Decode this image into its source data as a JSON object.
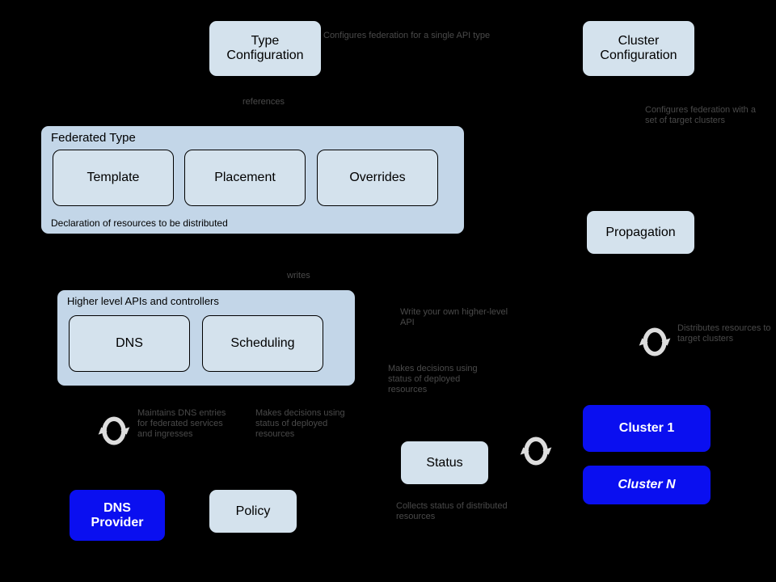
{
  "nodes": {
    "type_config": "Type\nConfiguration",
    "cluster_config": "Cluster\nConfiguration",
    "federated_type": {
      "title": "Federated Type",
      "subtitle": "Declaration of resources to be distributed",
      "template": "Template",
      "placement": "Placement",
      "overrides": "Overrides"
    },
    "propagation": "Propagation",
    "higher_apis": {
      "title": "Higher level APIs and controllers",
      "dns": "DNS",
      "scheduling": "Scheduling"
    },
    "dns_provider": "DNS\nProvider",
    "policy": "Policy",
    "status": "Status",
    "cluster1": "Cluster 1",
    "clusterN": "Cluster N"
  },
  "edges": {
    "type_to_prop": "Configures federation for a single API type",
    "cluster_to_prop": "Configures federation with a set of target clusters",
    "fed_references": "references",
    "sched_writes": "writes",
    "higher_api_note": "Write your own higher-level API",
    "sched_status": "Makes decisions using status of deployed resources",
    "dns_maintain": "Maintains DNS entries for federated services and ingresses",
    "policy_sched": "Makes decisions using status of deployed resources",
    "prop_clusters": "Distributes resources to target clusters",
    "status_collects": "Collects status of distributed resources"
  },
  "colors": {
    "light": "#d4e2ed",
    "blue": "#0a0ff0",
    "container": "#c3d6e8"
  }
}
